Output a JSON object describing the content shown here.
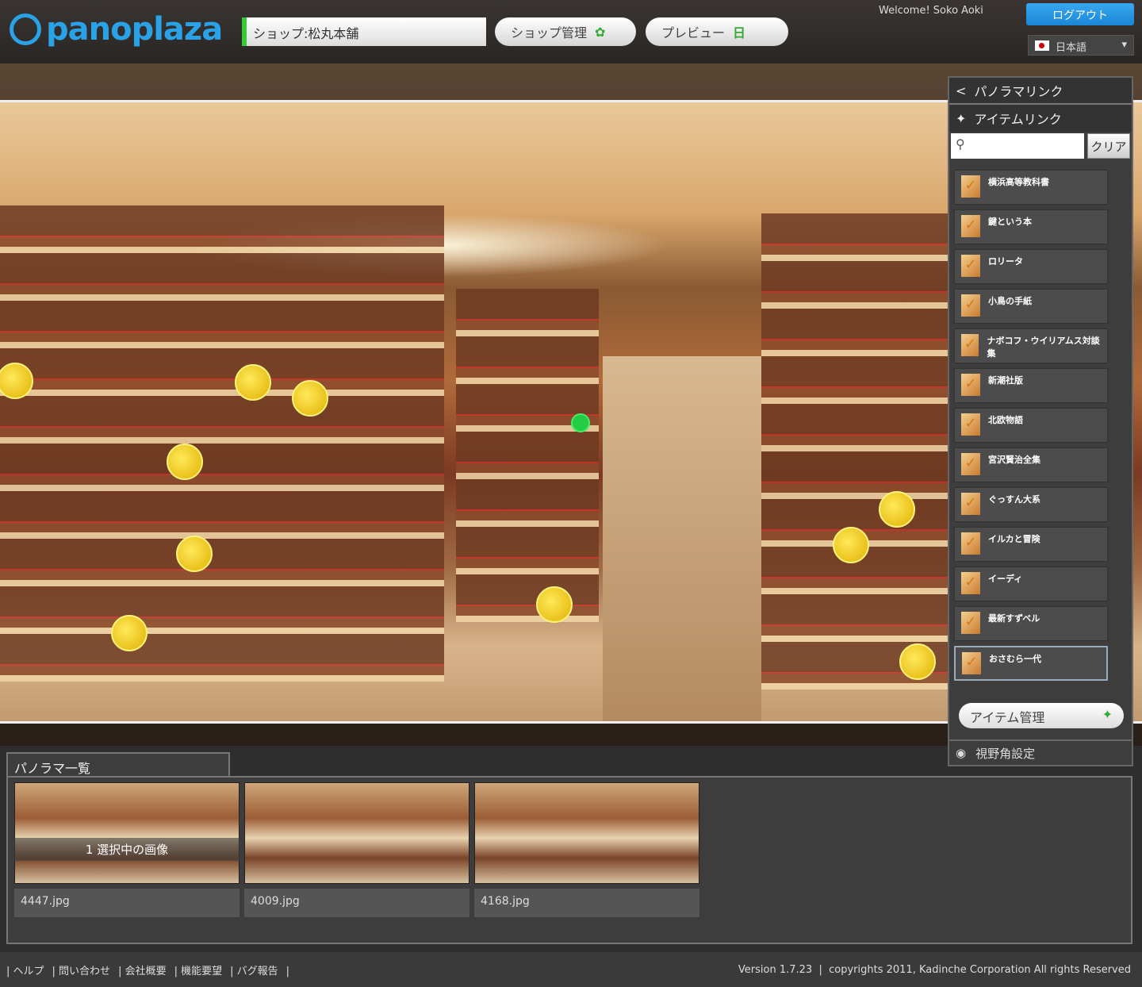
{
  "header": {
    "logo": "panoplaza",
    "shop_field": "ショップ:松丸本舗",
    "shop_manage": "ショップ管理",
    "preview": "プレビュー",
    "welcome": "Welcome! Soko Aoki",
    "logout": "ログアウト",
    "language": "日本語"
  },
  "sidebar": {
    "panorama_link": "パノラマリンク",
    "item_link": "アイテムリンク",
    "search_placeholder": "",
    "clear": "クリア",
    "items": [
      {
        "label": "横浜高等教科書"
      },
      {
        "label": "鍵という本"
      },
      {
        "label": "ロリータ"
      },
      {
        "label": "小鳥の手紙"
      },
      {
        "label": "ナボコフ・ウイリアムス対談集"
      },
      {
        "label": "新潮社版"
      },
      {
        "label": "北欧物語"
      },
      {
        "label": "宮沢賢治全集"
      },
      {
        "label": "ぐっすん大系"
      },
      {
        "label": "イルカと冒険"
      },
      {
        "label": "イーディ"
      },
      {
        "label": "最新すずベル"
      },
      {
        "label": "おさむら一代"
      }
    ],
    "item_manage": "アイテム管理",
    "view_setting": "視野角設定"
  },
  "panorama_list": {
    "title": "パノラマ一覧",
    "selected_overlay": "1 選択中の画像",
    "thumbs": [
      {
        "name": "4447.jpg"
      },
      {
        "name": "4009.jpg"
      },
      {
        "name": "4168.jpg"
      }
    ]
  },
  "footer": {
    "links": [
      "ヘルプ",
      "問い合わせ",
      "会社概要",
      "機能要望",
      "バグ報告"
    ],
    "version": "Version 1.7.23",
    "copyright": "copyrights 2011, Kadinche Corporation All rights Reserved"
  }
}
